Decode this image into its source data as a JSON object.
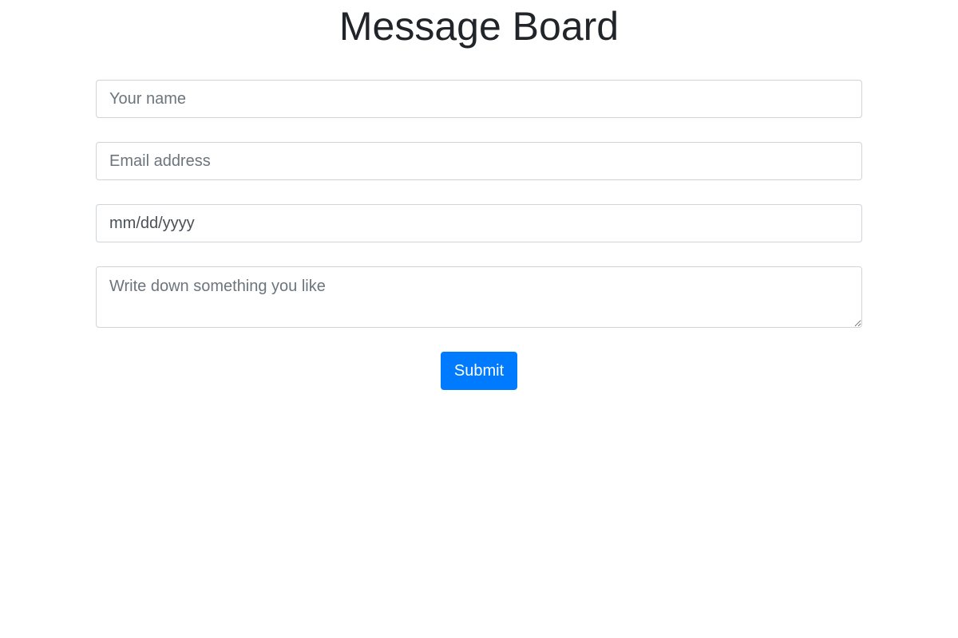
{
  "header": {
    "title": "Message Board"
  },
  "form": {
    "name": {
      "placeholder": "Your name",
      "value": ""
    },
    "email": {
      "placeholder": "Email address",
      "value": ""
    },
    "date": {
      "display": "mm/dd/yyyy"
    },
    "message": {
      "placeholder": "Write down something you like",
      "value": ""
    },
    "submit_label": "Submit"
  },
  "colors": {
    "accent": "#007bff",
    "border": "#ced4da",
    "title_text": "#212529",
    "placeholder_text": "#6c757d"
  }
}
